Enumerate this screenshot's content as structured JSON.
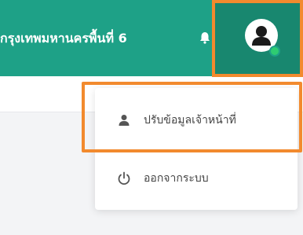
{
  "header": {
    "title": "กรุงเทพมหานครพื้นที่ 6",
    "notification_icon": "bell-icon",
    "profile_icon": "user-avatar-icon",
    "online_status_color": "#2ecc71"
  },
  "dropdown": {
    "items": [
      {
        "label": "ปรับข้อมูลเจ้าหน้าที่",
        "icon": "user-icon"
      },
      {
        "label": "ออกจากระบบ",
        "icon": "power-icon"
      }
    ]
  },
  "colors": {
    "header_bg": "#1ea187",
    "profile_bg": "#18876f",
    "highlight": "#f28a2e"
  }
}
